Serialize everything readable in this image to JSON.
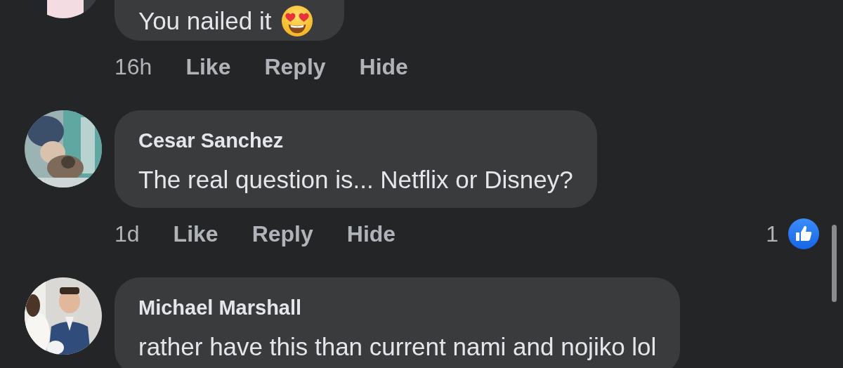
{
  "comments": [
    {
      "text": "You nailed it",
      "emoji": true,
      "actions": [
        {
          "kind": "time",
          "label": "16h"
        },
        {
          "kind": "action",
          "label": "Like"
        },
        {
          "kind": "action",
          "label": "Reply"
        },
        {
          "kind": "action",
          "label": "Hide"
        }
      ]
    },
    {
      "name": "Cesar Sanchez",
      "text": "The real question is... Netflix or Disney?",
      "actions": [
        {
          "kind": "time",
          "label": "1d"
        },
        {
          "kind": "action",
          "label": "Like"
        },
        {
          "kind": "action",
          "label": "Reply"
        },
        {
          "kind": "action",
          "label": "Hide"
        }
      ],
      "reactions": {
        "count": "1"
      }
    },
    {
      "name": "Michael Marshall",
      "text": "rather have this than current nami and nojiko lol"
    }
  ]
}
